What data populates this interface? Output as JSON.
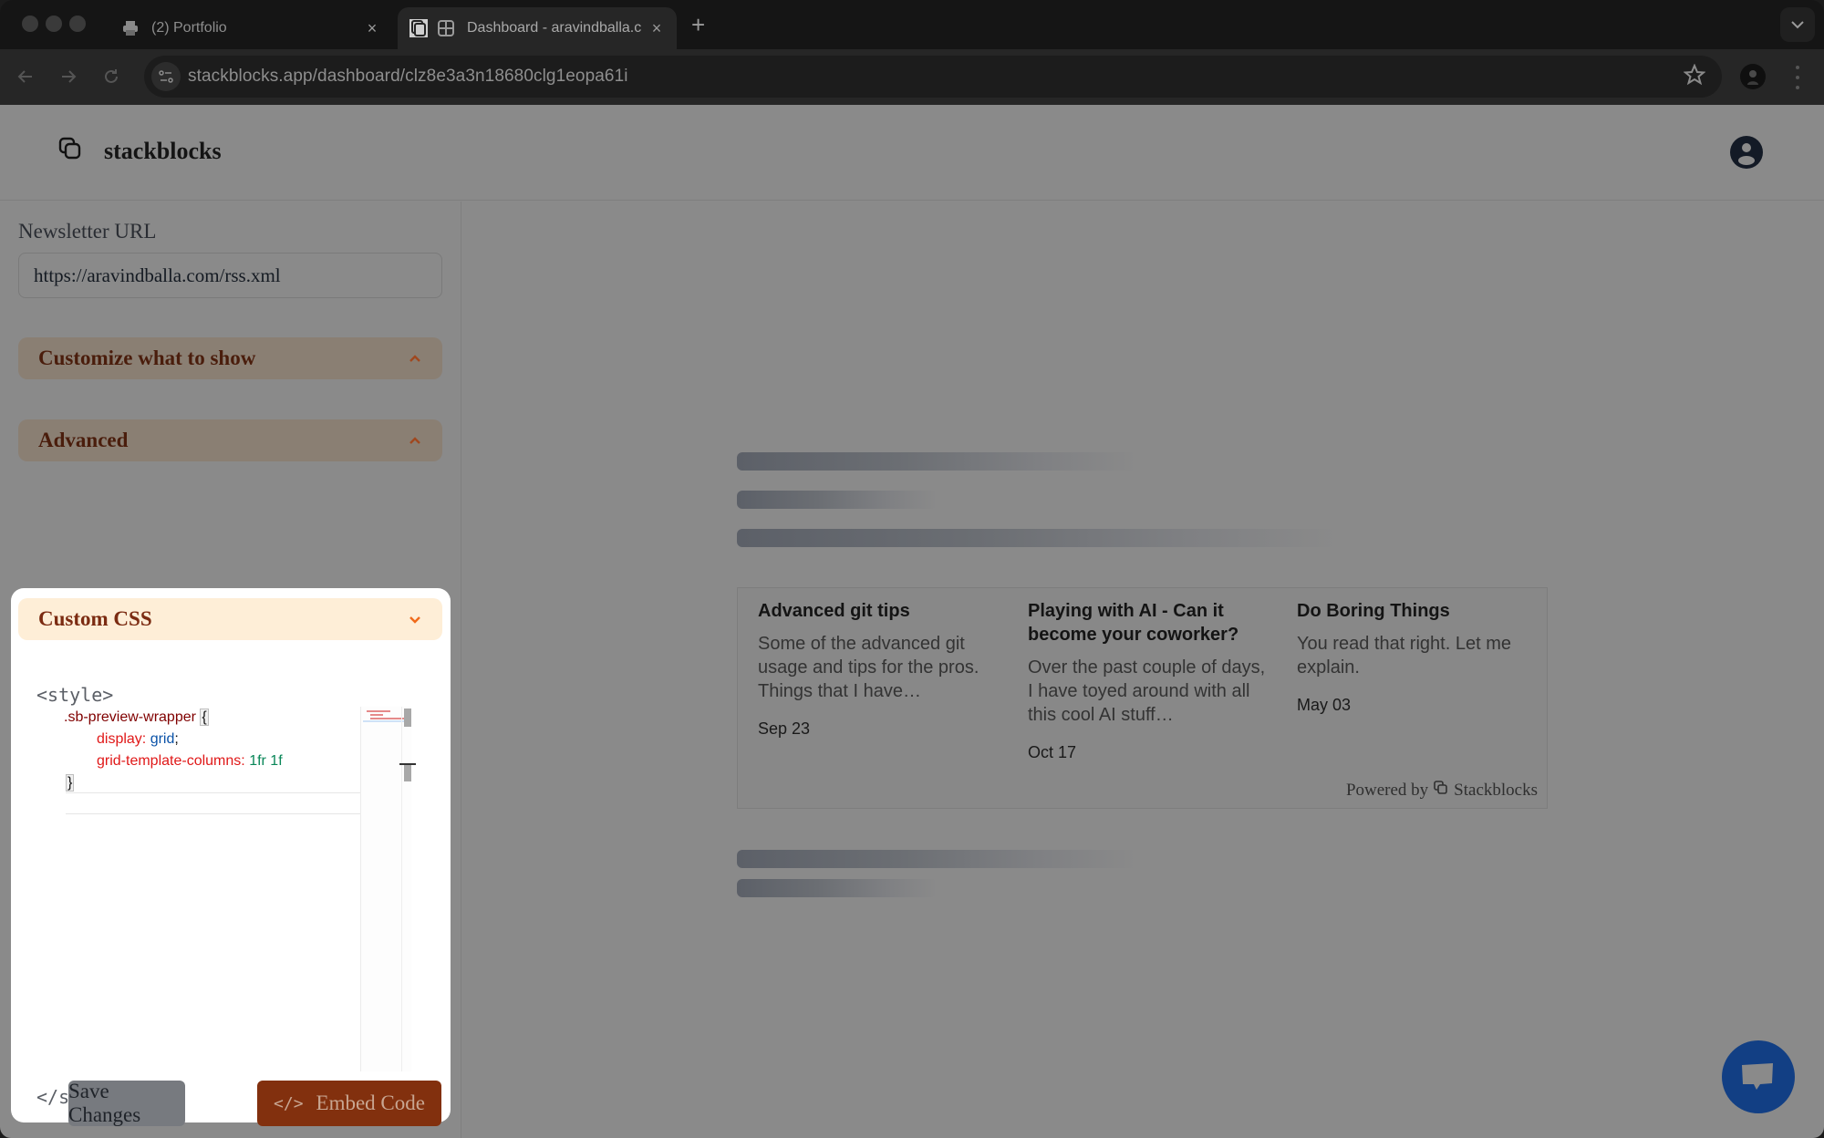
{
  "browser": {
    "tabs": [
      {
        "title": "(2) Portfolio",
        "icon": "printer-icon",
        "active": false
      },
      {
        "title": "Dashboard - aravindballa.c",
        "icon": "grid-icon",
        "active": true
      }
    ],
    "new_tab_label": "+",
    "close_label": "×",
    "url": "stackblocks.app/dashboard/clz8e3a3n18680clg1eopa61i"
  },
  "app": {
    "brand_name": "stackblocks"
  },
  "sidebar": {
    "newsletter_label": "Newsletter URL",
    "newsletter_value": "https://aravindballa.com/rss.xml",
    "sections": [
      {
        "title": "Customize what to show",
        "state": "collapsed",
        "chevron": "chevron-up-icon"
      },
      {
        "title": "Advanced",
        "state": "collapsed",
        "chevron": "chevron-up-icon"
      },
      {
        "title": "Custom CSS",
        "state": "expanded",
        "chevron": "chevron-down-icon"
      }
    ],
    "css_editor": {
      "open_tag": "<style>",
      "close_tag": "</style>",
      "lines": {
        "selector": ".sb-preview-wrapper",
        "open_brace": "{",
        "prop1": "display:",
        "val1": "grid",
        "semi": ";",
        "prop2": "grid-template-columns:",
        "val2": "1fr 1f",
        "close_brace": "}"
      }
    },
    "save_label": "Save Changes",
    "embed_label": "Embed Code",
    "embed_icon": "</>"
  },
  "preview": {
    "posts": [
      {
        "title": "Advanced git tips",
        "excerpt": "Some of the advanced git usage and tips for the pros. Things that I have…",
        "date": "Sep 23"
      },
      {
        "title": "Playing with AI - Can it become your coworker?",
        "excerpt": "Over the past couple of days, I have toyed around with all this cool AI stuff…",
        "date": "Oct 17"
      },
      {
        "title": "Do Boring Things",
        "excerpt": "You read that right. Let me explain.",
        "date": "May 03"
      }
    ],
    "powered_by": "Powered by",
    "powered_brand": "Stackblocks"
  },
  "colors": {
    "accent_dark": "#82300e",
    "accordion_text": "#7b2b11",
    "accordion_bg_active": "#feeed7",
    "chat_fab": "#123f84"
  }
}
